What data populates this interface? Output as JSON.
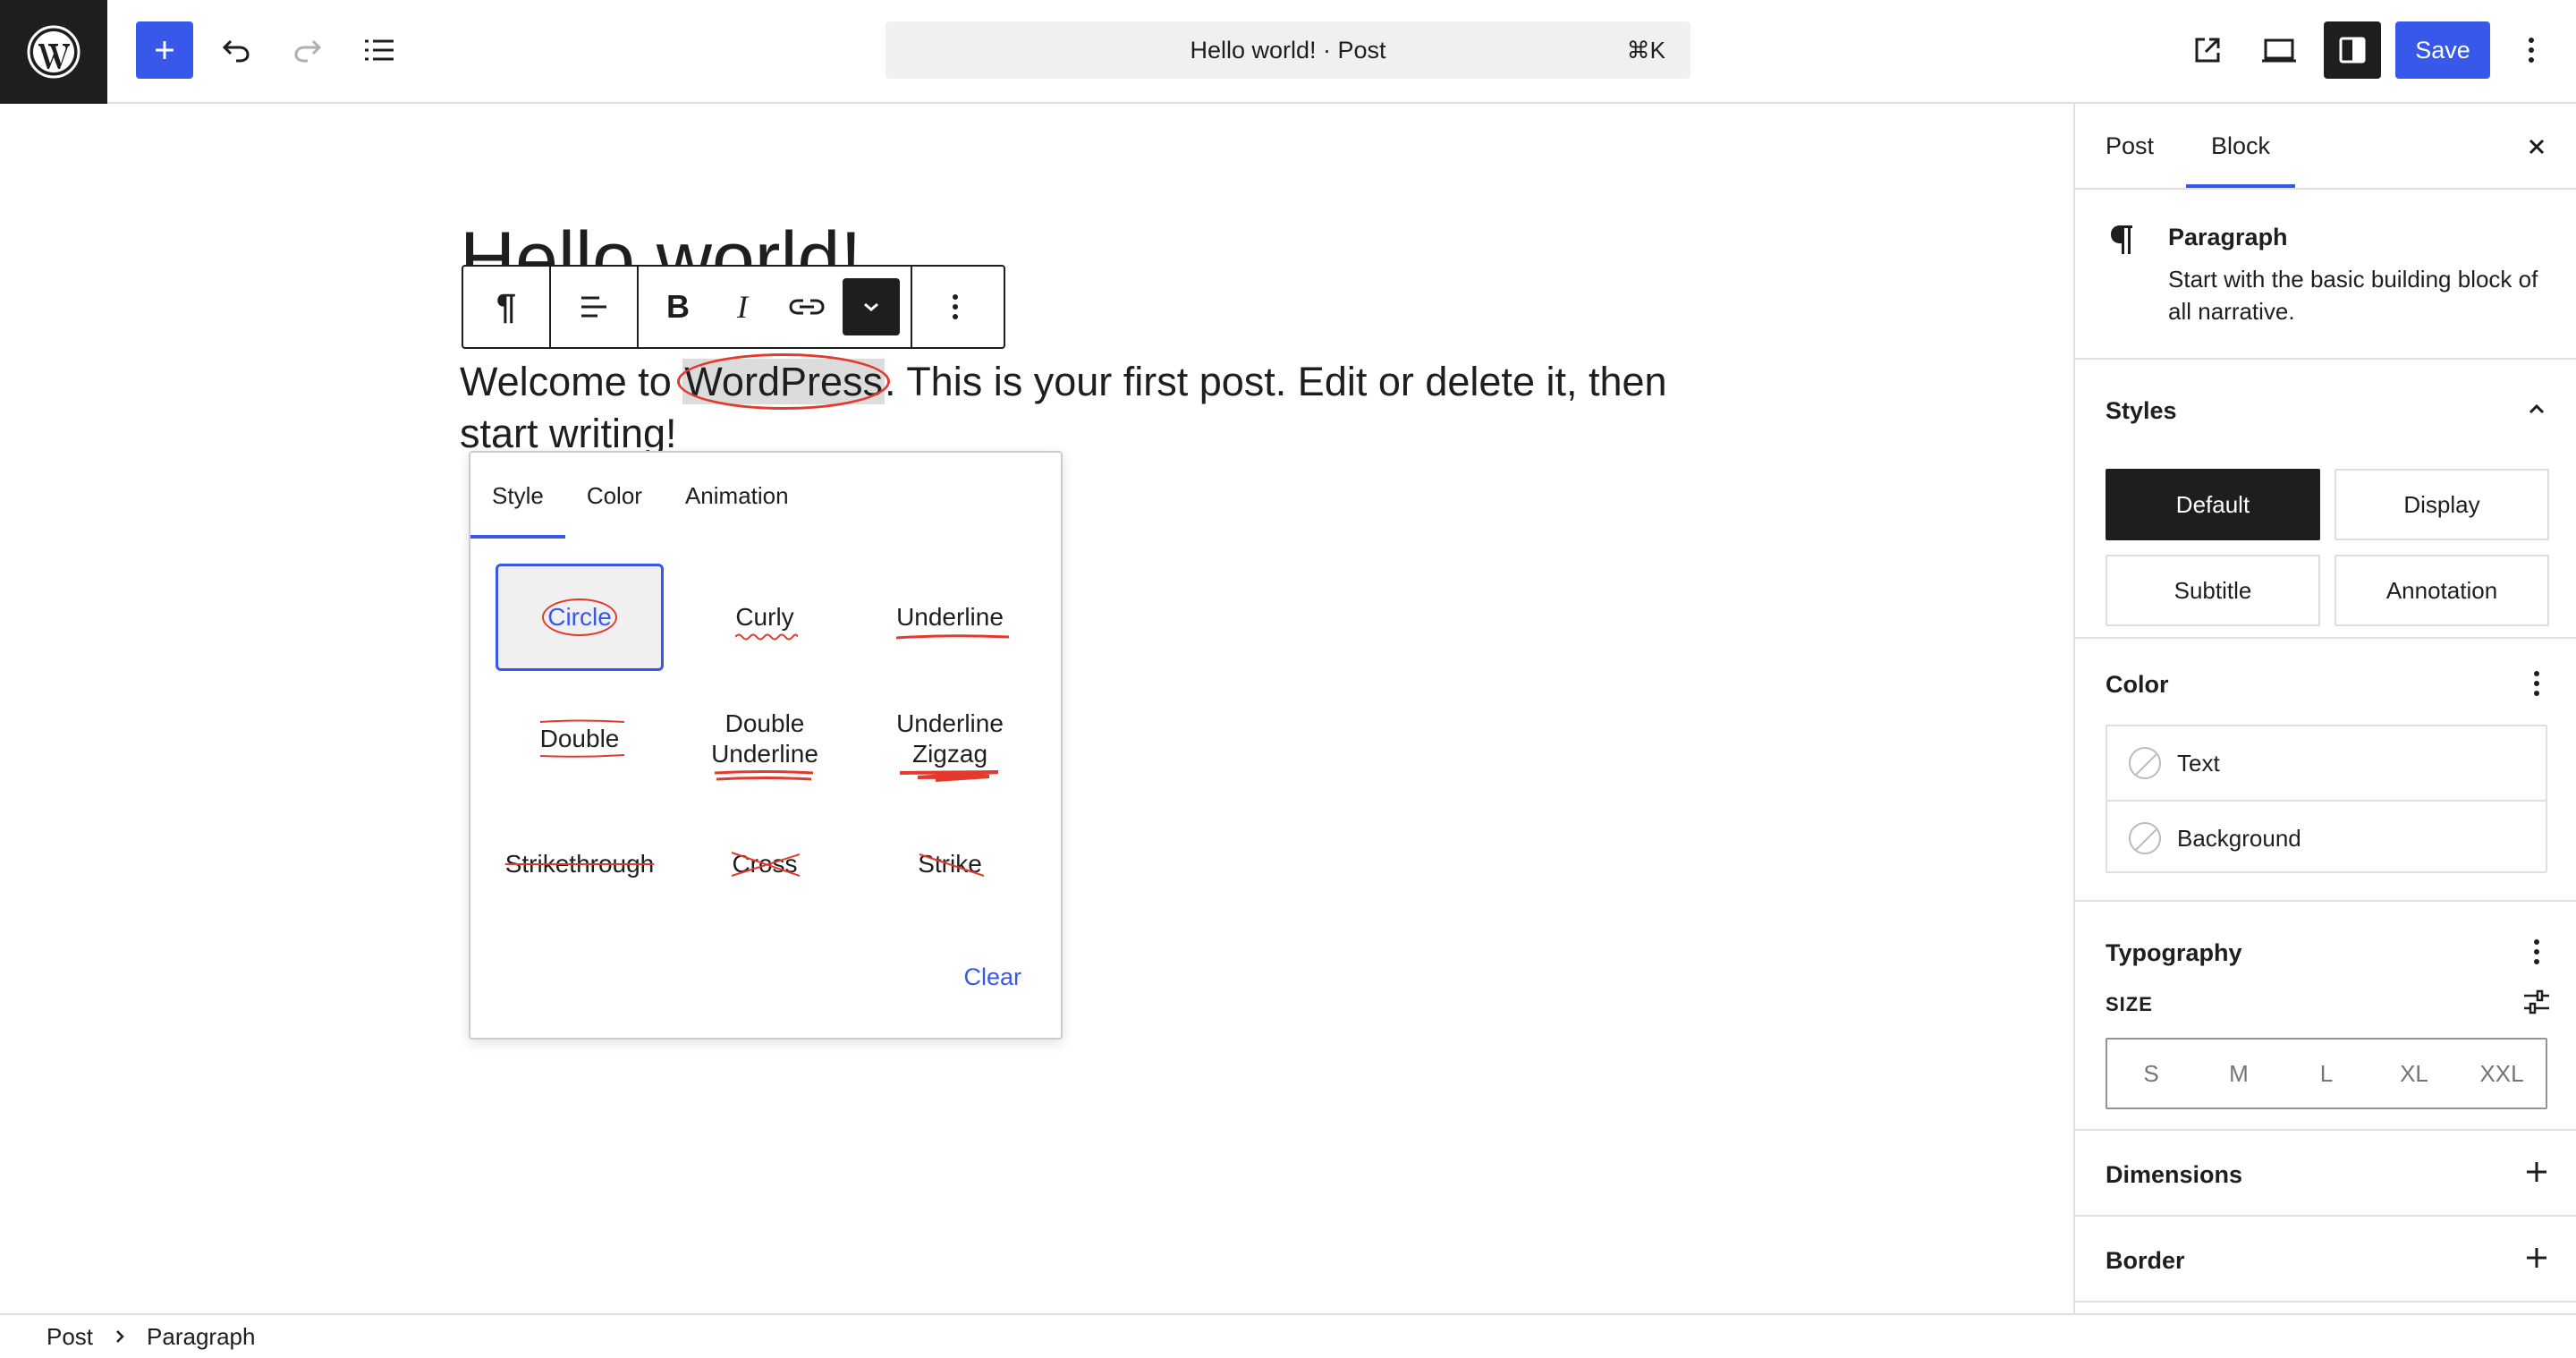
{
  "toolbar": {
    "logo_icon": "wordpress-logo",
    "add_icon": "plus-icon",
    "undo_icon": "undo-icon",
    "redo_icon": "redo-icon",
    "list_view_icon": "list-view-icon",
    "document_title": "Hello world!",
    "document_separator": " · ",
    "document_type": "Post",
    "shortcut": "⌘K",
    "view_icon": "external-link-icon",
    "device_icon": "desktop-icon",
    "settings_icon": "sidebar-icon",
    "save_label": "Save",
    "more_icon": "more-vertical-icon",
    "accent_color": "#3858e9"
  },
  "editor": {
    "post_title": "Hello world!",
    "paragraph_before": "Welcome to ",
    "paragraph_highlight": "WordPress",
    "paragraph_after": ". This is your first post. Edit or delete it, then",
    "paragraph_line2": "start writing!",
    "annotation_color": "#e23b2e"
  },
  "block_toolbar": {
    "items": [
      "paragraph-icon",
      "align-icon",
      "bold-icon",
      "italic-icon",
      "link-icon",
      "chevron-down-icon",
      "more-vertical-icon"
    ],
    "bold_glyph": "B",
    "italic_glyph": "I",
    "pilcrow_glyph": "¶"
  },
  "popover": {
    "tabs": [
      "Style",
      "Color",
      "Animation"
    ],
    "active_tab": "Style",
    "styles": [
      {
        "label": "Circle",
        "selected": true
      },
      {
        "label": "Curly"
      },
      {
        "label": "Underline"
      },
      {
        "label": "Double"
      },
      {
        "label_lines": [
          "Double",
          "Underline"
        ]
      },
      {
        "label_lines": [
          "Underline",
          "Zigzag"
        ]
      },
      {
        "label": "Strikethrough"
      },
      {
        "label": "Cross"
      },
      {
        "label": "Strike"
      }
    ],
    "clear_label": "Clear"
  },
  "sidebar": {
    "tabs": [
      "Post",
      "Block"
    ],
    "active_tab": "Block",
    "close_icon": "close-icon",
    "block_card": {
      "icon": "paragraph-icon",
      "name": "Paragraph",
      "description": "Start with the basic building block of all narrative."
    },
    "styles_panel": {
      "title": "Styles",
      "options": [
        "Default",
        "Display",
        "Subtitle",
        "Annotation"
      ],
      "selected": "Default"
    },
    "color_panel": {
      "title": "Color",
      "items": [
        "Text",
        "Background"
      ]
    },
    "typography_panel": {
      "title": "Typography",
      "size_label": "SIZE",
      "sizes": [
        "S",
        "M",
        "L",
        "XL",
        "XXL"
      ]
    },
    "dimensions_panel": {
      "title": "Dimensions"
    },
    "border_panel": {
      "title": "Border"
    }
  },
  "footer": {
    "breadcrumbs": [
      "Post",
      "Paragraph"
    ]
  }
}
